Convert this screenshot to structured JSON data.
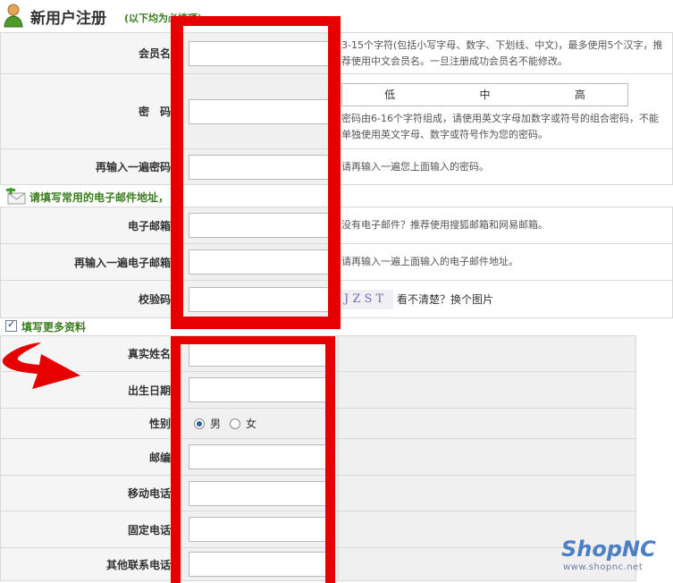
{
  "header": {
    "title": "新用户注册",
    "note": "(以下均为必填项)"
  },
  "required_fields": [
    {
      "label": "会员名",
      "hint": "3-15个字符(包括小写字母、数字、下划线、中文)，最多使用5个汉字，推荐使用中文会员名。一旦注册成功会员名不能修改。"
    },
    {
      "label": "密　码",
      "hint": "密码由6-16个字符组成，请使用英文字母加数字或符号的组合密码，不能单独使用英文字母、数字或符号作为您的密码。"
    },
    {
      "label": "再输入一遍密码",
      "hint": "请再输入一遍您上面输入的密码。"
    }
  ],
  "password_strength": {
    "low": "低",
    "mid": "中",
    "high": "高"
  },
  "email_section": {
    "title": "请填写常用的电子邮件地址，",
    "fields": [
      {
        "label": "电子邮箱",
        "hint": "没有电子邮件？推荐使用搜狐邮箱和网易邮箱。"
      },
      {
        "label": "再输入一遍电子邮箱",
        "hint": "请再输入一遍上面输入的电子邮件地址。"
      }
    ],
    "captcha": {
      "label": "校验码",
      "text": "J Z S T",
      "refresh": "看不清楚？换个图片"
    }
  },
  "more_section": {
    "title": "填写更多资料",
    "checked": true,
    "fields": [
      {
        "label": "真实姓名"
      },
      {
        "label": "出生日期"
      },
      {
        "label": "性别",
        "options": [
          "男",
          "女"
        ],
        "selected": "男"
      },
      {
        "label": "邮编"
      },
      {
        "label": "移动电话"
      },
      {
        "label": "固定电话"
      },
      {
        "label": "其他联系电话"
      }
    ]
  },
  "logo": {
    "name": "ShopNC",
    "url": "www.shopnc.net"
  },
  "colors": {
    "highlight": "#e60000",
    "section_title": "#3a7d1f",
    "label_bg": "#f5f5f5"
  }
}
